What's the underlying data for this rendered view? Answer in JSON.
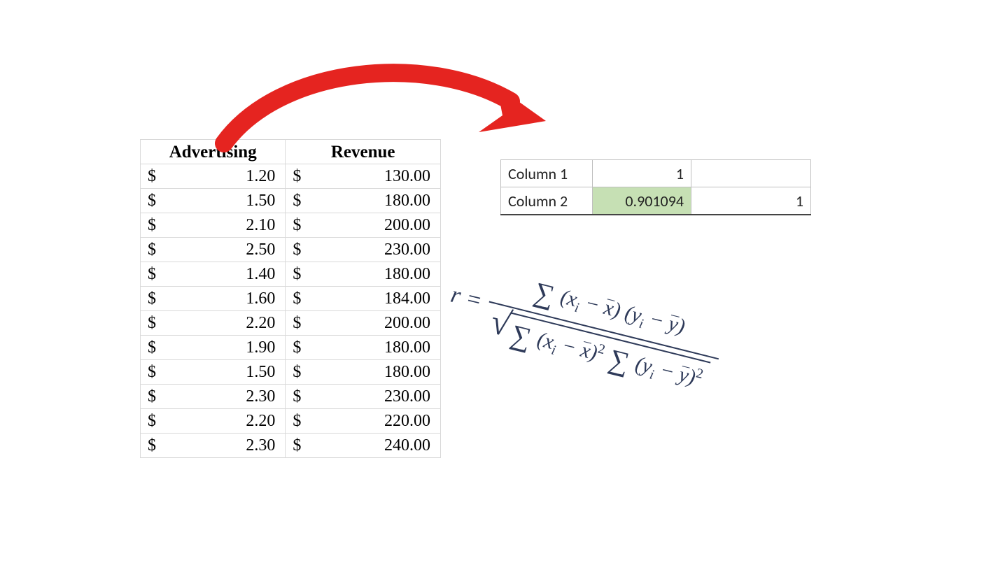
{
  "data_table": {
    "headers": {
      "advertising": "Advertising",
      "revenue": "Revenue"
    },
    "currency": "$",
    "rows": [
      {
        "adv": "1.20",
        "rev": "130.00"
      },
      {
        "adv": "1.50",
        "rev": "180.00"
      },
      {
        "adv": "2.10",
        "rev": "200.00"
      },
      {
        "adv": "2.50",
        "rev": "230.00"
      },
      {
        "adv": "1.40",
        "rev": "180.00"
      },
      {
        "adv": "1.60",
        "rev": "184.00"
      },
      {
        "adv": "2.20",
        "rev": "200.00"
      },
      {
        "adv": "1.90",
        "rev": "180.00"
      },
      {
        "adv": "1.50",
        "rev": "180.00"
      },
      {
        "adv": "2.30",
        "rev": "230.00"
      },
      {
        "adv": "2.20",
        "rev": "220.00"
      },
      {
        "adv": "2.30",
        "rev": "240.00"
      }
    ]
  },
  "corr_matrix": {
    "row1_label": "Column 1",
    "row1_val1": "1",
    "row1_val2": "",
    "row2_label": "Column 2",
    "row2_val1": "0.901094",
    "row2_val2": "1"
  },
  "formula": {
    "lhs": "r =",
    "numerator_parts": {
      "sigma": "∑",
      "lp": "(",
      "xi": "x",
      "isub": "i",
      "minus": " − ",
      "xb": "x",
      "rp": ") ",
      "lp2": "(",
      "yi": "y",
      "yb": "y",
      "rp2": ")"
    },
    "denominator_parts": {
      "sigma": "∑",
      "sq": "2"
    }
  },
  "colors": {
    "highlight": "#c6e0b4",
    "arrow": "#e52420",
    "formula_ink": "#2e3a59"
  }
}
